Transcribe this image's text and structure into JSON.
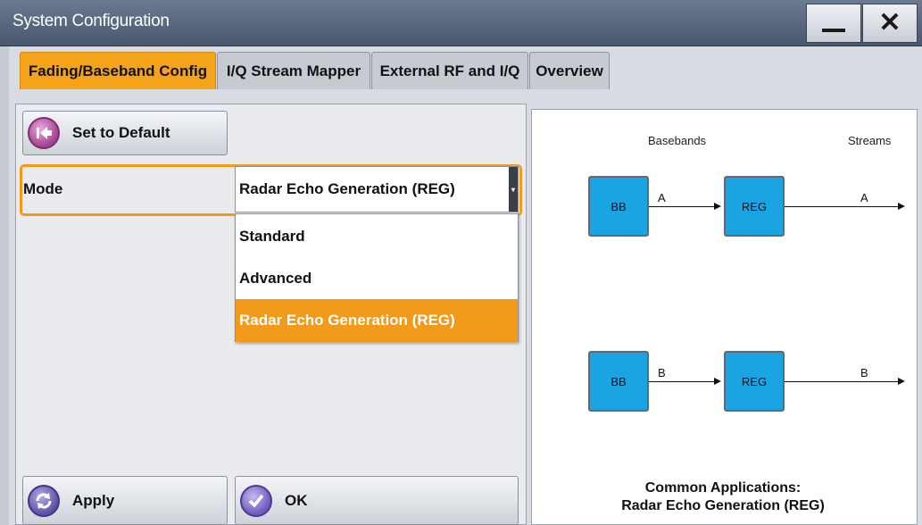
{
  "window": {
    "title": "System Configuration",
    "minimize_icon": "minimize-icon",
    "close_icon": "close-icon"
  },
  "tabs": [
    {
      "label": "Fading/Baseband Config",
      "active": true
    },
    {
      "label": "I/Q Stream Mapper",
      "active": false
    },
    {
      "label": "External RF and I/Q",
      "active": false
    },
    {
      "label": "Overview",
      "active": false
    }
  ],
  "left_panel": {
    "set_default_label": "Set to Default",
    "mode_label": "Mode",
    "mode_value": "Radar Echo Generation (REG)",
    "mode_options": [
      "Standard",
      "Advanced",
      "Radar Echo Generation (REG)"
    ],
    "mode_selected_index": 2,
    "apply_label": "Apply",
    "ok_label": "OK"
  },
  "diagram": {
    "header_basebands": "Basebands",
    "header_streams": "Streams",
    "row_a": {
      "source": "BB",
      "target": "REG",
      "in_label": "A",
      "out_label": "A"
    },
    "row_b": {
      "source": "BB",
      "target": "REG",
      "in_label": "B",
      "out_label": "B"
    },
    "caption_line1": "Common Applications:",
    "caption_line2": "Radar Echo Generation (REG)"
  },
  "colors": {
    "accent": "#f39a1a",
    "block_fill": "#1aa4e4",
    "title_bar": "#5b6a82"
  }
}
